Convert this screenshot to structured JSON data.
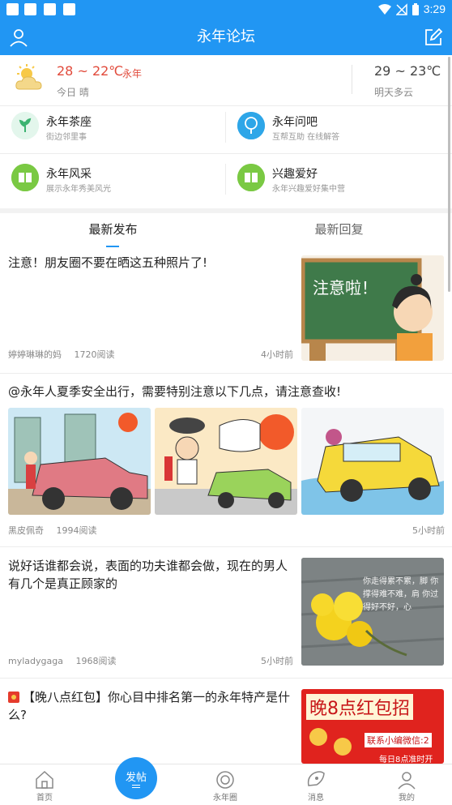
{
  "status_bar": {
    "time": "3:29"
  },
  "header": {
    "title": "永年论坛",
    "left_icon": "user-icon",
    "right_icon": "edit-icon"
  },
  "weather": {
    "today_temp": "28 ~ 22℃",
    "city": "永年",
    "today_desc": "今日 晴",
    "tomorrow_temp": "29 ~ 23℃",
    "tomorrow_desc": "明天多云"
  },
  "categories": [
    {
      "title": "永年茶座",
      "subtitle": "街边邻里事",
      "icon": "leaf-icon",
      "color": "#4cc38a"
    },
    {
      "title": "永年问吧",
      "subtitle": "互帮互助 在线解答",
      "icon": "tree-icon",
      "color": "#2ea6e8"
    },
    {
      "title": "永年风采",
      "subtitle": "展示永年秀美风光",
      "icon": "book-icon",
      "color": "#7ac943"
    },
    {
      "title": "兴趣爱好",
      "subtitle": "永年兴趣爱好集中营",
      "icon": "book-icon",
      "color": "#7ac943"
    }
  ],
  "tabs": [
    {
      "label": "最新发布"
    },
    {
      "label": "最新回复"
    }
  ],
  "posts": [
    {
      "title": "注意！朋友圈不要在晒这五种照片了!",
      "author": "婷婷琳琳的妈",
      "views": "1720阅读",
      "time": "4小时前",
      "thumb_text": "注意啦！"
    },
    {
      "title": "@永年人夏季安全出行，需要特别注意以下几点，请注意查收!",
      "author": "黑皮佩奇",
      "views": "1994阅读",
      "time": "5小时前"
    },
    {
      "title": "说好话谁都会说，表面的功夫谁都会做，现在的男人有几个是真正顾家的",
      "author": "myladygaga",
      "views": "1968阅读",
      "time": "5小时前",
      "thumb_text": "你走得累不累，脚 你撑得难不难，肩 你过得好不好，心"
    },
    {
      "title": "【晚八点红包】你心目中排名第一的永年特产是什么?",
      "thumb_text": "晚8点红包招",
      "thumb_sub": "联系小编微信:2",
      "thumb_sub2": "每日8点准时开"
    }
  ],
  "bottom_nav": [
    {
      "label": "首页",
      "icon": "home-icon"
    },
    {
      "label": "永年圈",
      "icon": "circle-icon"
    },
    {
      "label": "消息",
      "icon": "message-icon"
    },
    {
      "label": "我的",
      "icon": "profile-icon"
    }
  ],
  "fab": {
    "label": "发帖"
  },
  "colors": {
    "primary": "#2196F3",
    "temp_red": "#e14a3b"
  }
}
